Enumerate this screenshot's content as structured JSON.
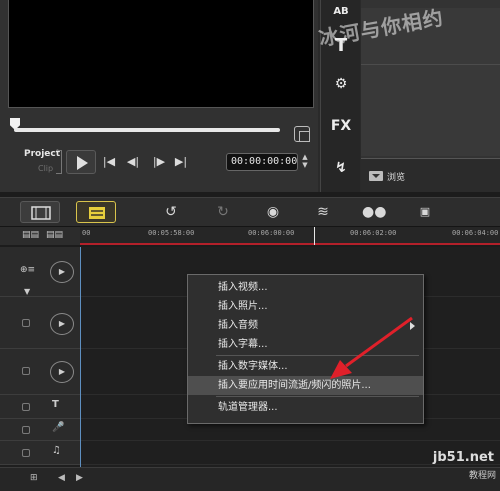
{
  "preview": {
    "mode_project": "Project",
    "mode_clip": "Clip",
    "timecode": "00:00:00:00"
  },
  "tools": {
    "title_label": "T",
    "fx_label": "FX",
    "top_label": "AB"
  },
  "library": {
    "browse_label": "浏览"
  },
  "watermark": "冰河与你相约",
  "ruler": {
    "ticks": [
      "00",
      "00:05:58:00",
      "00:06:00:00",
      "00:06:02:00",
      "00:06:04:00"
    ]
  },
  "menu": {
    "items": [
      {
        "label": "插入视频..."
      },
      {
        "label": "插入照片..."
      },
      {
        "label": "插入音频"
      },
      {
        "label": "插入字幕..."
      },
      {
        "label": "插入数字媒体..."
      },
      {
        "label": "插入要应用时间流逝/频闪的照片..."
      },
      {
        "label": "轨道管理器..."
      }
    ]
  },
  "site": {
    "domain": "jb51.net",
    "name": "教程网"
  },
  "colors": {
    "accent_timeline": "#d9c44c",
    "playhead_line": "#b3202a",
    "arrow": "#e0202a"
  }
}
